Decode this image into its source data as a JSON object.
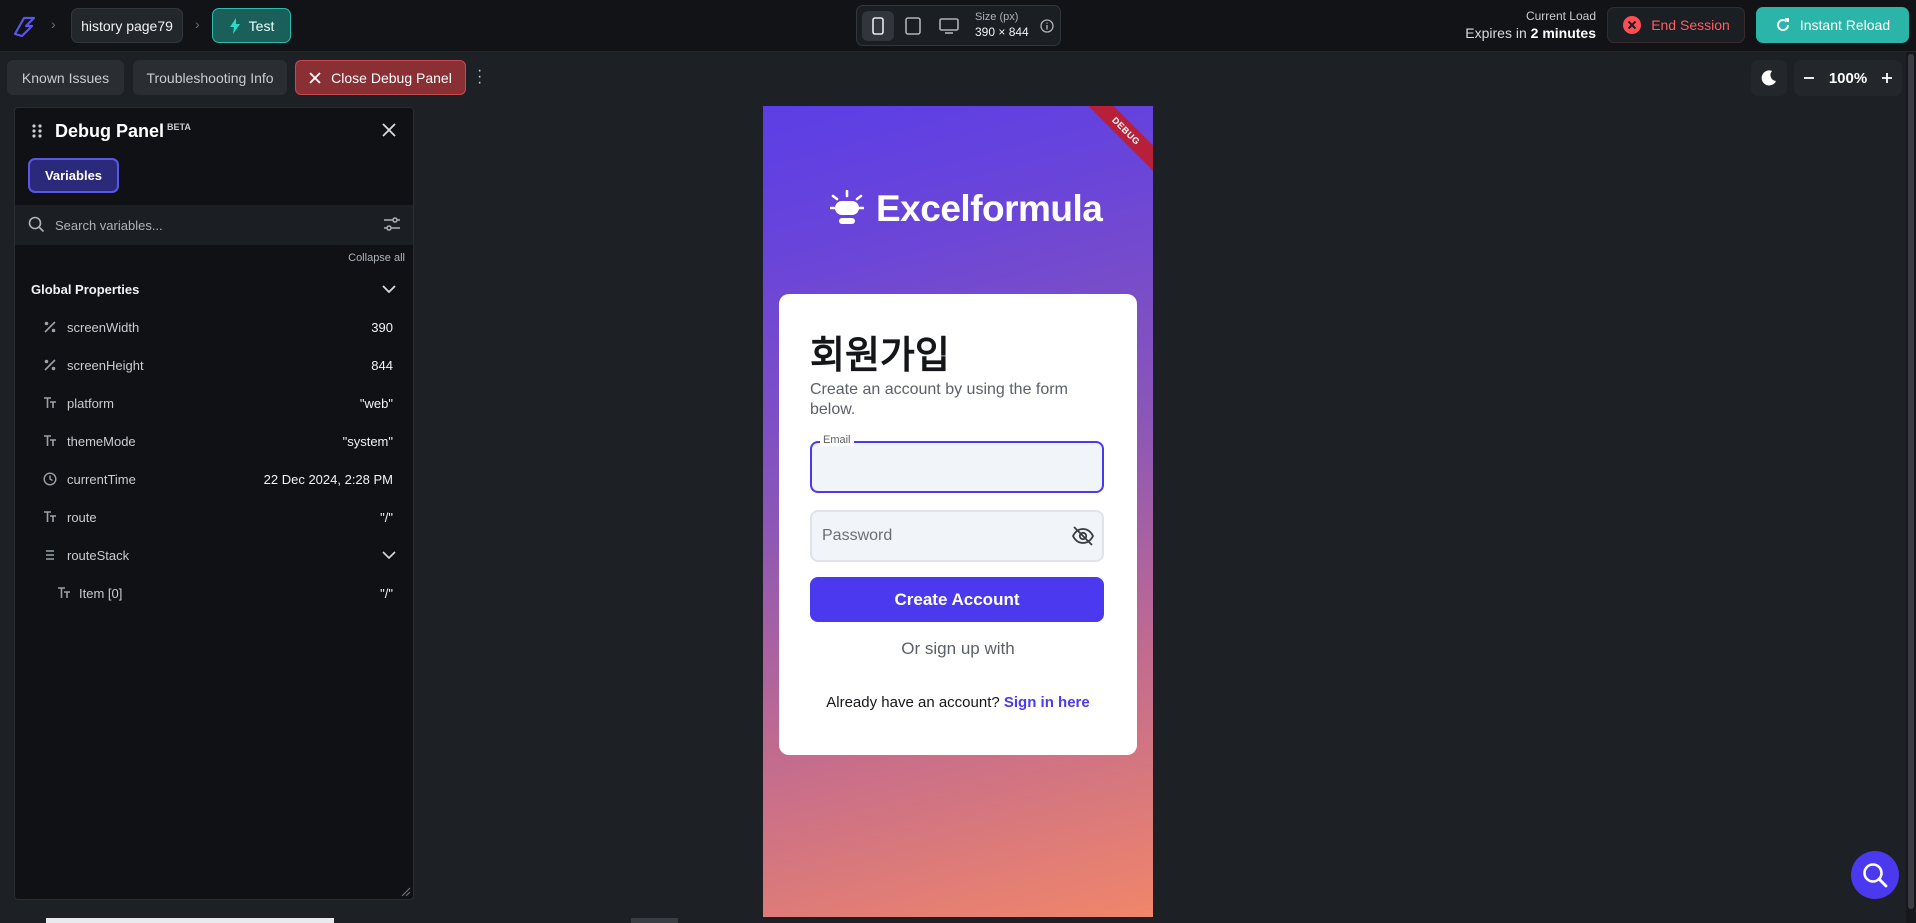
{
  "topbar": {
    "project": "history page79",
    "mode": "Test",
    "size_label": "Size (px)",
    "size_value": "390 × 844",
    "load_label": "Current Load",
    "expires_prefix": "Expires in",
    "expires_value": "2 minutes",
    "end_session": "End Session",
    "instant_reload": "Instant Reload"
  },
  "toolbar": {
    "known_issues": "Known Issues",
    "troubleshooting": "Troubleshooting Info",
    "close_debug": "Close Debug Panel",
    "zoom": "100%"
  },
  "debug_panel": {
    "title": "Debug Panel",
    "badge": "BETA",
    "tab": "Variables",
    "search_placeholder": "Search variables...",
    "collapse_all": "Collapse all",
    "group": "Global Properties",
    "vars": [
      {
        "icon": "percent-icon",
        "name": "screenWidth",
        "value": "390"
      },
      {
        "icon": "percent-icon",
        "name": "screenHeight",
        "value": "844"
      },
      {
        "icon": "text-icon",
        "name": "platform",
        "value": "\"web\""
      },
      {
        "icon": "text-icon",
        "name": "themeMode",
        "value": "\"system\""
      },
      {
        "icon": "clock-icon",
        "name": "currentTime",
        "value": "22 Dec 2024, 2:28 PM"
      },
      {
        "icon": "text-icon",
        "name": "route",
        "value": "\"/\""
      },
      {
        "icon": "list-icon",
        "name": "routeStack",
        "value": ""
      },
      {
        "icon": "text-icon",
        "name": "Item [0]",
        "value": "\"/\""
      }
    ]
  },
  "phone": {
    "ribbon": "DEBUG",
    "brand": "Excelformula",
    "title": "회원가입",
    "subtitle": "Create an account by using the form below.",
    "email_label": "Email",
    "password_placeholder": "Password",
    "create_button": "Create Account",
    "or_text": "Or sign up with",
    "have_account": "Already have an account?",
    "sign_in": "Sign in here"
  },
  "colors": {
    "accent": "#4b39ef",
    "teal": "#2bb5a8",
    "danger": "#ff5c63"
  }
}
